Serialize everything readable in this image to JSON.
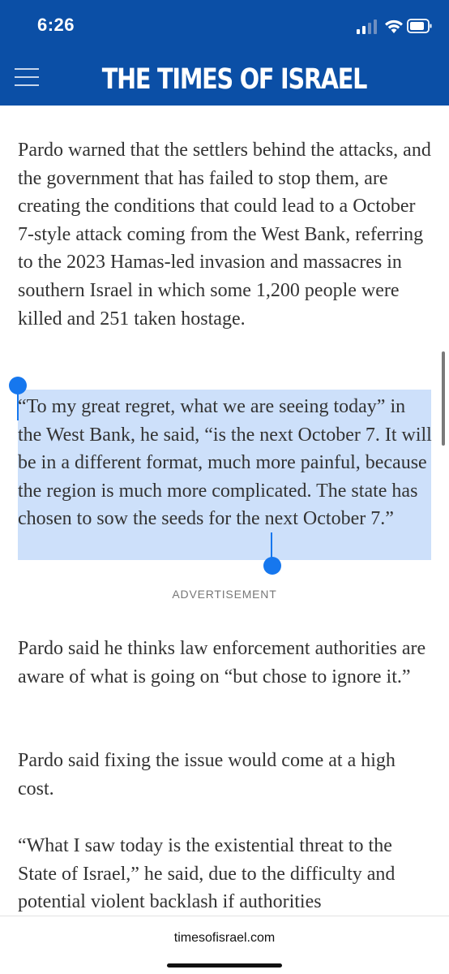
{
  "status_bar": {
    "time": "6:26",
    "icons": [
      "signal-icon",
      "wifi-icon",
      "battery-icon"
    ]
  },
  "header": {
    "brand": "THE TIMES OF ISRAEL",
    "menu_icon": "hamburger-menu-icon",
    "background_color": "#0b4fa6"
  },
  "article": {
    "paragraphs": [
      "Pardo warned that the settlers behind the attacks, and the government that has failed to stop them, are creating the conditions that could lead to a October 7-style attack coming from the West Bank, referring to the 2023 Hamas-led invasion and massacres in southern Israel in which some 1,200 people were killed and 251 taken hostage.",
      "“To my great regret, what we are seeing today” in the West Bank, he said, “is the next October 7. It will be in a different format, much more painful, because the region is much more complicated. The state has chosen to sow the seeds for the next October 7.”",
      "Pardo said he thinks law enforcement authorities are aware of what is going on “but chose to ignore it.”",
      "Pardo said fixing the issue would come at a high cost.",
      "“What I saw today is the existential threat to the State of Israel,” he said, due to the difficulty and potential violent backlash if authorities"
    ],
    "selected_paragraph_index": 1,
    "selection_color": "#cde0fa",
    "ad_label": "ADVERTISEMENT"
  },
  "browser": {
    "url": "timesofisrael.com"
  }
}
